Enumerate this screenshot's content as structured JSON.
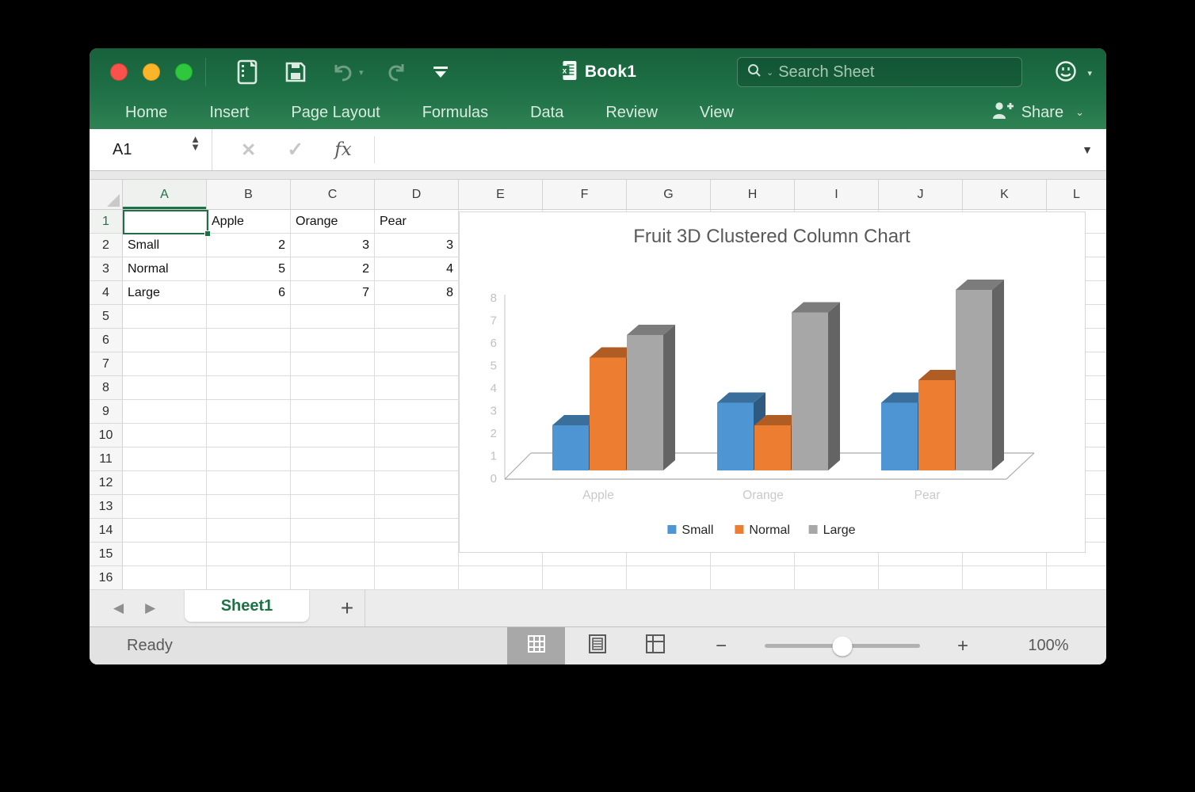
{
  "titlebar": {
    "document_title": "Book1",
    "search_placeholder": "Search Sheet"
  },
  "ribbon_tabs": [
    "Home",
    "Insert",
    "Page Layout",
    "Formulas",
    "Data",
    "Review",
    "View"
  ],
  "share_label": "Share",
  "formula_bar": {
    "cell_reference": "A1",
    "fx_label": "fx",
    "formula_value": ""
  },
  "grid": {
    "column_letters": [
      "A",
      "B",
      "C",
      "D",
      "E",
      "F",
      "G",
      "H",
      "I",
      "J",
      "K",
      "L"
    ],
    "row_count": 16,
    "selected_cell": "A1",
    "selected_column": "A",
    "selected_row": 1
  },
  "sheet_data": {
    "columns": [
      "",
      "Apple",
      "Orange",
      "Pear"
    ],
    "rows": [
      {
        "label": "Small",
        "values": [
          2,
          3,
          3
        ]
      },
      {
        "label": "Normal",
        "values": [
          5,
          2,
          4
        ]
      },
      {
        "label": "Large",
        "values": [
          6,
          7,
          8
        ]
      }
    ]
  },
  "chart_data": {
    "type": "bar",
    "subtype": "3d-clustered-column",
    "title": "Fruit 3D Clustered Column Chart",
    "categories": [
      "Apple",
      "Orange",
      "Pear"
    ],
    "series": [
      {
        "name": "Small",
        "color": "#4E96D3",
        "values": [
          2,
          3,
          3
        ]
      },
      {
        "name": "Normal",
        "color": "#ED7D31",
        "values": [
          5,
          2,
          4
        ]
      },
      {
        "name": "Large",
        "color": "#A7A7A7",
        "values": [
          6,
          7,
          8
        ]
      }
    ],
    "ylim": [
      0,
      8
    ],
    "ytick_interval": 1,
    "legend_position": "bottom",
    "grid": false,
    "title_color": "#595959",
    "axis_label_color": "#c0c0c0",
    "category_label_color": "#c9c9c9"
  },
  "sheet_bar": {
    "tabs": [
      {
        "label": "Sheet1",
        "active": true
      }
    ],
    "add_label": "+"
  },
  "status_bar": {
    "status": "Ready",
    "zoom_level": "100%"
  }
}
